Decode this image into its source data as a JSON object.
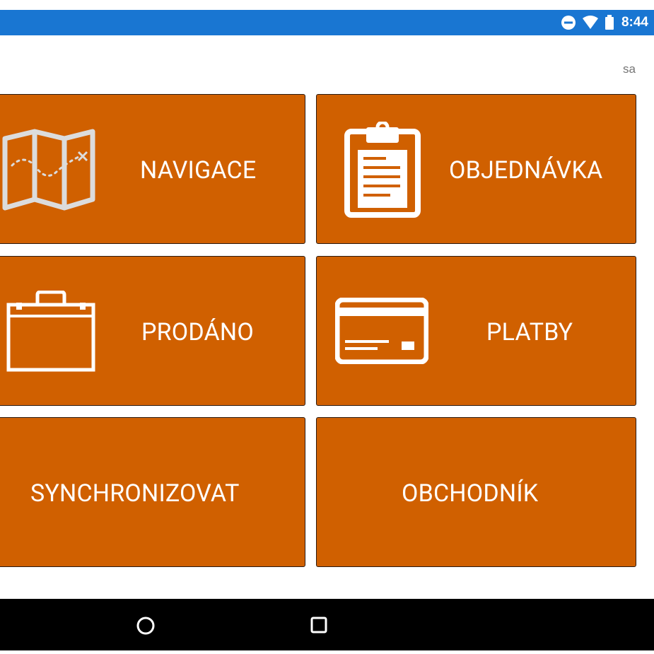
{
  "status_bar": {
    "time": "8:44",
    "color": "#1976d2",
    "icons": [
      "do-not-disturb-icon",
      "wifi-icon",
      "battery-icon"
    ]
  },
  "header": {
    "user_label": "sa"
  },
  "tiles": [
    {
      "label": "NAVIGACE",
      "icon": "map-icon"
    },
    {
      "label": "OBJEDNÁVKA",
      "icon": "clipboard-icon"
    },
    {
      "label": "PRODÁNO",
      "icon": "briefcase-icon"
    },
    {
      "label": "PLATBY",
      "icon": "credit-card-icon"
    },
    {
      "label": "SYNCHRONIZOVAT",
      "icon": null
    },
    {
      "label": "OBCHODNÍK",
      "icon": null
    }
  ],
  "theme": {
    "tile_color": "#d06000",
    "nav_bar_color": "#000000"
  },
  "nav_bar": {
    "buttons": [
      "home-button",
      "recents-button"
    ]
  }
}
